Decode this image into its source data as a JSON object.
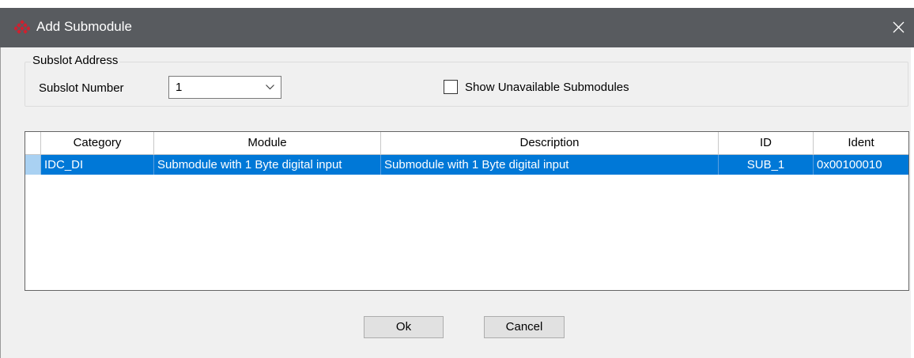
{
  "window": {
    "title": "Add Submodule",
    "icon": "red-diamond-app-icon",
    "close_icon": "close-icon"
  },
  "subslot_group": {
    "legend": "Subslot Address",
    "number_label": "Subslot Number",
    "number_value": "1"
  },
  "show_unavailable": {
    "label": "Show Unavailable Submodules",
    "checked": false
  },
  "table": {
    "columns": [
      "Category",
      "Module",
      "Description",
      "ID",
      "Ident"
    ],
    "rows": [
      {
        "category": "IDC_DI",
        "module": "Submodule with 1 Byte digital input",
        "description": "Submodule with 1 Byte digital input",
        "id": "SUB_1",
        "ident": "0x00100010",
        "selected": true
      }
    ]
  },
  "buttons": {
    "ok": "Ok",
    "cancel": "Cancel"
  },
  "colors": {
    "titlebar": "#585b5f",
    "selection": "#0078d7",
    "icon_red": "#d0202f"
  }
}
